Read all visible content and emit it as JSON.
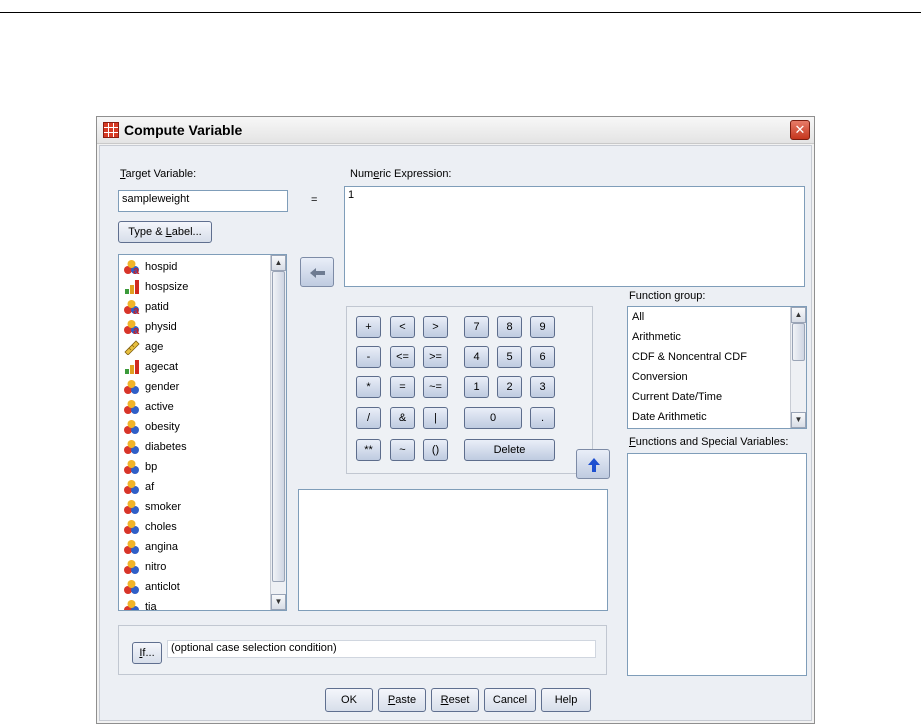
{
  "dialog": {
    "title": "Compute Variable",
    "close_glyph": "✕"
  },
  "target": {
    "label_prefix": "",
    "label_mnemonic": "T",
    "label_rest": "arget Variable:",
    "value": "sampleweight",
    "equals": "="
  },
  "type_label_button": {
    "pre": "Type & ",
    "mnemonic": "L",
    "post": "abel..."
  },
  "numeric_expression": {
    "label_pre": "Num",
    "label_mnemonic": "e",
    "label_post": "ric Expression:",
    "value": "1"
  },
  "variables": [
    {
      "name": "hospid",
      "icon": "nominal-string-icon"
    },
    {
      "name": "hospsize",
      "icon": "ordinal-icon"
    },
    {
      "name": "patid",
      "icon": "nominal-string-icon"
    },
    {
      "name": "physid",
      "icon": "nominal-string-icon"
    },
    {
      "name": "age",
      "icon": "scale-icon"
    },
    {
      "name": "agecat",
      "icon": "ordinal-icon"
    },
    {
      "name": "gender",
      "icon": "nominal-icon"
    },
    {
      "name": "active",
      "icon": "nominal-icon"
    },
    {
      "name": "obesity",
      "icon": "nominal-icon"
    },
    {
      "name": "diabetes",
      "icon": "nominal-icon"
    },
    {
      "name": "bp",
      "icon": "nominal-icon"
    },
    {
      "name": "af",
      "icon": "nominal-icon"
    },
    {
      "name": "smoker",
      "icon": "nominal-icon"
    },
    {
      "name": "choles",
      "icon": "nominal-icon"
    },
    {
      "name": "angina",
      "icon": "nominal-icon"
    },
    {
      "name": "nitro",
      "icon": "nominal-icon"
    },
    {
      "name": "anticlot",
      "icon": "nominal-icon"
    },
    {
      "name": "tia",
      "icon": "nominal-icon"
    }
  ],
  "keypad": {
    "keys": [
      "+",
      "<",
      ">",
      "7",
      "8",
      "9",
      "-",
      "<=",
      ">=",
      "4",
      "5",
      "6",
      "*",
      "=",
      "~=",
      "1",
      "2",
      "3",
      "/",
      "&",
      "|",
      "0",
      ".",
      "**",
      "~",
      "()",
      "Delete"
    ]
  },
  "function_group": {
    "label_pre": "Function ",
    "label_mnemonic": "g",
    "label_post": "roup:",
    "items": [
      "All",
      "Arithmetic",
      "CDF & Noncentral CDF",
      "Conversion",
      "Current Date/Time",
      "Date Arithmetic"
    ]
  },
  "functions_special": {
    "label_pre": "",
    "label_mnemonic": "F",
    "label_post": "unctions and Special Variables:"
  },
  "if_section": {
    "button_mnemonic": "I",
    "button_rest": "f...",
    "condition_text": "(optional case selection condition)"
  },
  "footer_buttons": {
    "ok": "OK",
    "paste_mnemonic": "P",
    "paste_rest": "aste",
    "reset_mnemonic": "R",
    "reset_rest": "eset",
    "cancel": "Cancel",
    "help": "Help"
  }
}
